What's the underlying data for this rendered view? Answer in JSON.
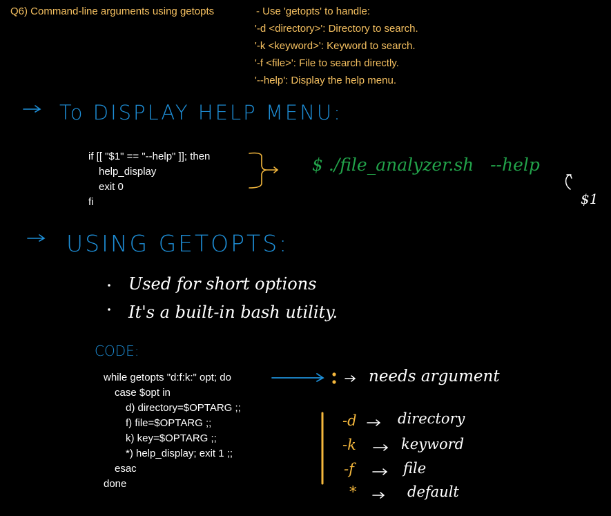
{
  "question": {
    "title": "Q6) Command-line arguments using getopts",
    "bullets": [
      "- Use 'getopts' to handle:",
      "'-d <directory>': Directory to search.",
      "'-k <keyword>': Keyword to search.",
      "'-f <file>': File to search directly.",
      "'--help': Display the help menu."
    ]
  },
  "help_section": {
    "heading": "To DISPLAY HELP MENU:",
    "code_lines": [
      "if [[ \"$1\" == \"--help\" ]]; then",
      "help_display",
      "exit 0",
      "fi"
    ],
    "command": "$ ./file_analyzer.sh   --help",
    "arg_label": "$1"
  },
  "getopts_section": {
    "heading": "USING GETOPTS:",
    "points": [
      "Used for short options",
      "It's a built-in bash utility."
    ],
    "code_label": "CODE:",
    "code_lines": [
      "while getopts \"d:f:k:\" opt; do",
      "case $opt in",
      "d) directory=$OPTARG ;;",
      "f) file=$OPTARG ;;",
      "k) key=$OPTARG ;;",
      "*) help_display; exit 1 ;;",
      "esac",
      "done"
    ],
    "colon_note": "needs argument",
    "legend": [
      {
        "flag": "-d",
        "meaning": "directory"
      },
      {
        "flag": "-k",
        "meaning": "keyword"
      },
      {
        "flag": "-f",
        "meaning": "file"
      },
      {
        "flag": "*",
        "meaning": "default"
      }
    ]
  },
  "colors": {
    "background": "#000000",
    "question_text": "#f5c060",
    "handwriting_blue": "#1e8fd8",
    "handwriting_green": "#22a34a",
    "accent_orange": "#f5b83d"
  }
}
